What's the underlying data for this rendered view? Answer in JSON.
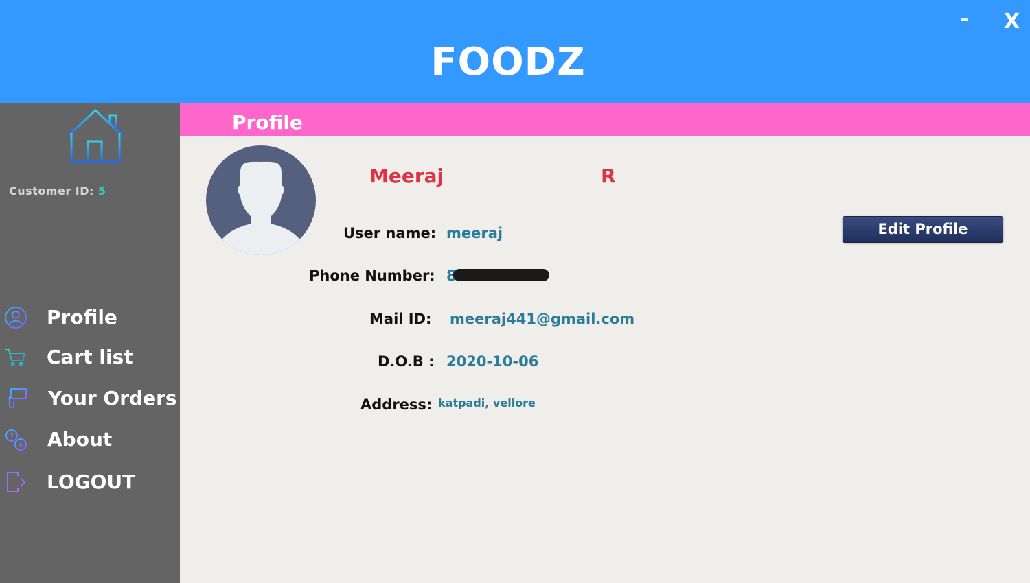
{
  "window": {
    "title": "FOODZ",
    "minimize_label": "-",
    "close_label": "X"
  },
  "sidebar": {
    "customer_id_label": "Customer ID:",
    "customer_id_value": "5",
    "items": [
      {
        "label": "Profile",
        "icon": "user-circle-icon"
      },
      {
        "label": "Cart list",
        "icon": "cart-icon"
      },
      {
        "label": "Your Orders",
        "icon": "orders-icon"
      },
      {
        "label": "About",
        "icon": "about-icon"
      },
      {
        "label": "LOGOUT",
        "icon": "logout-icon"
      }
    ]
  },
  "content": {
    "header_label": "Profile",
    "first_name": "Meeraj",
    "last_name": "R",
    "edit_button_label": "Edit Profile",
    "fields": {
      "username_label": "User name:",
      "username_value": "meeraj",
      "phone_label": "Phone Number:",
      "phone_value": "8",
      "mail_label": "Mail ID:",
      "mail_value": "meeraj441@gmail.com",
      "dob_label": "D.O.B :",
      "dob_value": "2020-10-06",
      "address_label": "Address:",
      "address_value": "katpadi, vellore"
    }
  },
  "colors": {
    "titlebar": "#3399ff",
    "sidebar": "#646464",
    "content_header": "#ff66cc",
    "name": "#dd3344",
    "value": "#2a7a9a",
    "button": "#26386a"
  }
}
